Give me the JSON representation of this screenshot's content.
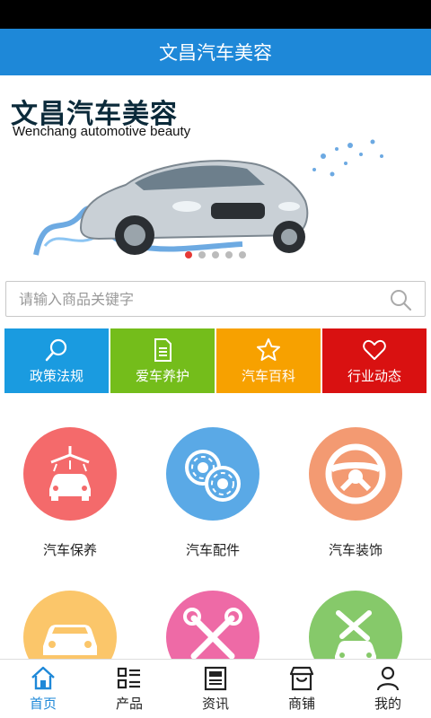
{
  "header": {
    "title": "文昌汽车美容"
  },
  "banner": {
    "title": "文昌汽车美容",
    "subtitle": "Wenchang automotive beauty",
    "slide_count": 5,
    "active_slide": 1
  },
  "search": {
    "placeholder": "请输入商品关键字",
    "value": ""
  },
  "quick_links": [
    {
      "label": "政策法规",
      "icon": "search-icon",
      "color": "#1a9be0"
    },
    {
      "label": "爱车养护",
      "icon": "document-icon",
      "color": "#74bd1b"
    },
    {
      "label": "汽车百科",
      "icon": "star-icon",
      "color": "#f7a100"
    },
    {
      "label": "行业动态",
      "icon": "heart-icon",
      "color": "#d91111"
    }
  ],
  "categories": [
    {
      "label": "汽车保养",
      "icon": "car-wash-icon",
      "color": "#f46a6b"
    },
    {
      "label": "汽车配件",
      "icon": "wheels-icon",
      "color": "#5aa9e6"
    },
    {
      "label": "汽车装饰",
      "icon": "steering-wheel-icon",
      "color": "#f39a72"
    },
    {
      "label": "",
      "icon": "car-icon",
      "color": "#fbc66a"
    },
    {
      "label": "",
      "icon": "wrench-icon",
      "color": "#ee6aa6"
    },
    {
      "label": "",
      "icon": "car-repair-icon",
      "color": "#86c96a"
    }
  ],
  "bottom_nav": [
    {
      "label": "首页",
      "icon": "home-icon",
      "active": true
    },
    {
      "label": "产品",
      "icon": "grid-list-icon",
      "active": false
    },
    {
      "label": "资讯",
      "icon": "news-icon",
      "active": false
    },
    {
      "label": "商铺",
      "icon": "shop-icon",
      "active": false
    },
    {
      "label": "我的",
      "icon": "user-icon",
      "active": false
    }
  ],
  "colors": {
    "accent": "#1e88d8"
  }
}
